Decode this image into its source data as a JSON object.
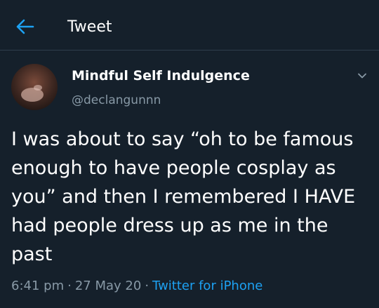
{
  "header": {
    "title": "Tweet"
  },
  "tweet": {
    "display_name": "Mindful Self Indulgence",
    "handle": "@declangunnn",
    "text": "I was about to say “oh to be famous enough to have people cosplay as you” and then I remembered I HAVE had people dress up as me in the past",
    "time": "6:41 pm",
    "date": "27 May 20",
    "source": "Twitter for iPhone",
    "separator": "·"
  },
  "colors": {
    "background": "#15202b",
    "accent": "#1da1f2",
    "secondary_text": "#8899a6"
  },
  "icons": {
    "back": "back-arrow-icon",
    "more": "chevron-down-icon"
  }
}
